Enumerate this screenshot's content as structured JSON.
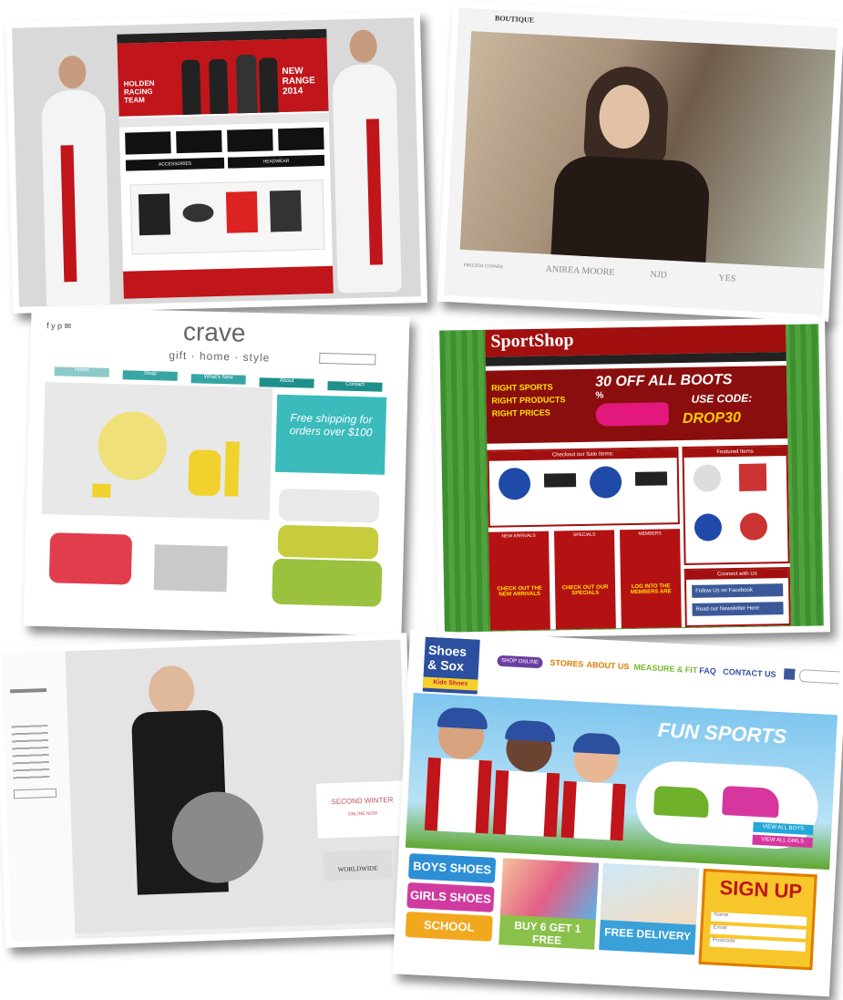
{
  "holden": {
    "title": "HOLDEN RACING TEAM",
    "banner": "NEW RANGE 2014",
    "categories": [
      "ACCESSORIES",
      "HEADWEAR"
    ]
  },
  "boutique": {
    "tab": "BOUTIQUE",
    "brands": [
      "FREEZER CONNER",
      "ANIREA MOORE",
      "NJD",
      "YES"
    ]
  },
  "crave": {
    "logo": "crave",
    "tagline": "gift · home · style",
    "nav": [
      "Home",
      "Shop",
      "What's New",
      "About",
      "Contact"
    ],
    "promo": "Free shipping for orders over $100"
  },
  "sportshop": {
    "logo": "SportShop",
    "slogan": [
      "RIGHT SPORTS",
      "RIGHT PRODUCTS",
      "RIGHT PRICES"
    ],
    "promo_headline": "30 OFF ALL BOOTS",
    "promo_percent": "%",
    "promo_use": "USE CODE:",
    "promo_code": "DROP30",
    "sale_heading": "Checkout our Sale Items:",
    "featured_heading": "Featured Items",
    "sections": [
      "NEW ARRIVALS",
      "SPECIALS",
      "MEMBERS"
    ],
    "section_ctas": [
      "CHECK OUT THE NEW ARRIVALS",
      "CHECK OUT OUR SPECIALS",
      "LOG INTO THE MEMBERS ARE"
    ],
    "connect_heading": "Connect with Us",
    "facebook": "Follow Us on Facebook",
    "newsletter": "Read our Newsletter Here"
  },
  "winter": {
    "headline": "SECOND WINTER",
    "cta": "ONLINE NOW",
    "badge": "WORLDWIDE"
  },
  "shoes": {
    "logo_line1": "Shoes",
    "logo_line2": "& Sox",
    "logo_sub": "Kids Shoes",
    "nav": [
      "SHOP ONLINE",
      "STORES",
      "ABOUT US",
      "MEASURE & FIT",
      "FAQ",
      "CONTACT US"
    ],
    "hero_title": "FUN SPORTS",
    "view_boys": "VIEW ALL BOYS",
    "view_girls": "VIEW ALL GIRLS",
    "tiles": [
      "BOYS SHOES",
      "GIRLS SHOES",
      "SCHOOL SHOES"
    ],
    "promo1": "BUY 6 GET 1 FREE",
    "promo2": "FREE DELIVERY",
    "signup": "SIGN UP",
    "signup_fields": [
      "Name",
      "Email",
      "Postcode"
    ]
  }
}
